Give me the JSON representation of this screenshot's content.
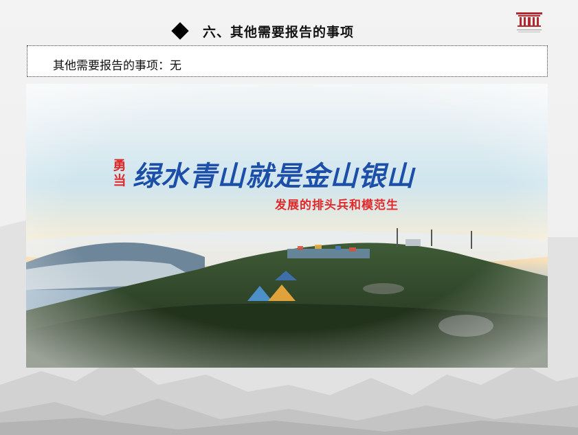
{
  "slide": {
    "title": "六、其他需要报告的事项",
    "notice": "其他需要报告的事项：无"
  },
  "banner": {
    "prefix": "勇当",
    "slogan": "绿水青山就是金山银山",
    "subtitle": "发展的排头兵和模范生"
  },
  "colors": {
    "title": "#111111",
    "slogan_blue": "#1c4fa8",
    "accent_red": "#e2282a"
  },
  "icons": {
    "bullet": "diamond-icon",
    "logo": "emblem-logo"
  }
}
